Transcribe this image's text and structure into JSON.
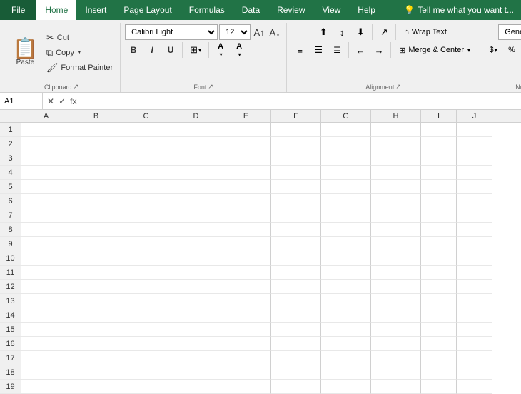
{
  "menu": {
    "file_label": "File",
    "items": [
      {
        "label": "Home",
        "active": true
      },
      {
        "label": "Insert",
        "active": false
      },
      {
        "label": "Page Layout",
        "active": false
      },
      {
        "label": "Formulas",
        "active": false
      },
      {
        "label": "Data",
        "active": false
      },
      {
        "label": "Review",
        "active": false
      },
      {
        "label": "View",
        "active": false
      },
      {
        "label": "Help",
        "active": false
      }
    ],
    "tell_me": "Tell me what you want t..."
  },
  "ribbon": {
    "clipboard": {
      "group_label": "Clipboard",
      "paste_label": "Paste",
      "cut_label": "Cut",
      "copy_label": "Copy",
      "format_painter_label": "Format Painter"
    },
    "font": {
      "group_label": "Font",
      "font_name": "Calibri Light",
      "font_size": "12",
      "bold": "B",
      "italic": "I",
      "underline": "U",
      "highlight_color": "#FFFF00",
      "font_color": "#FF0000"
    },
    "alignment": {
      "group_label": "Alignment",
      "wrap_text": "Wrap Text",
      "merge_center": "Merge & Center"
    },
    "number": {
      "group_label": "Number",
      "format": "General"
    }
  },
  "spreadsheet": {
    "name_box": "A1",
    "columns": [
      "A",
      "B",
      "C",
      "D",
      "E",
      "F",
      "G",
      "H",
      "I",
      "J"
    ],
    "rows": [
      1,
      2,
      3,
      4,
      5,
      6,
      7,
      8,
      9,
      10,
      11,
      12,
      13,
      14,
      15,
      16,
      17,
      18,
      19
    ]
  }
}
